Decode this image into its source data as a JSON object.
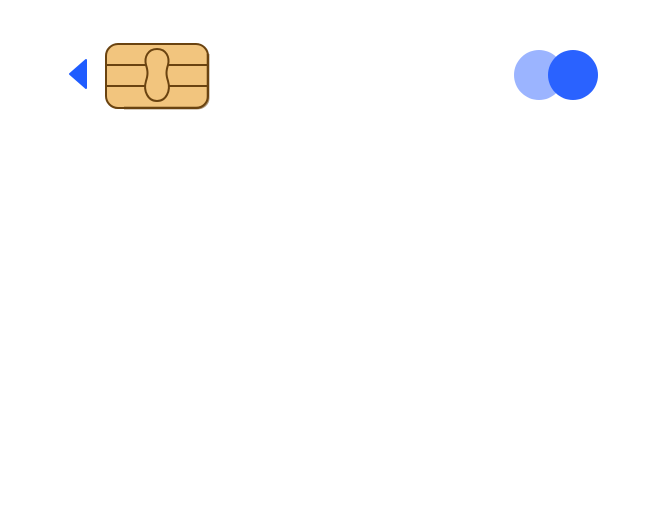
{
  "card": {
    "icons": {
      "back": "chevron-left-icon",
      "chip": "emv-chip-icon",
      "brand": "card-network-logo-icon"
    },
    "colors": {
      "background": "#ffffff",
      "accent": "#1f5cff",
      "logo_left": "#9bb4ff",
      "logo_right": "#2a62ff",
      "chip_fill": "#f2c57e",
      "chip_outline": "#6a4310"
    }
  }
}
